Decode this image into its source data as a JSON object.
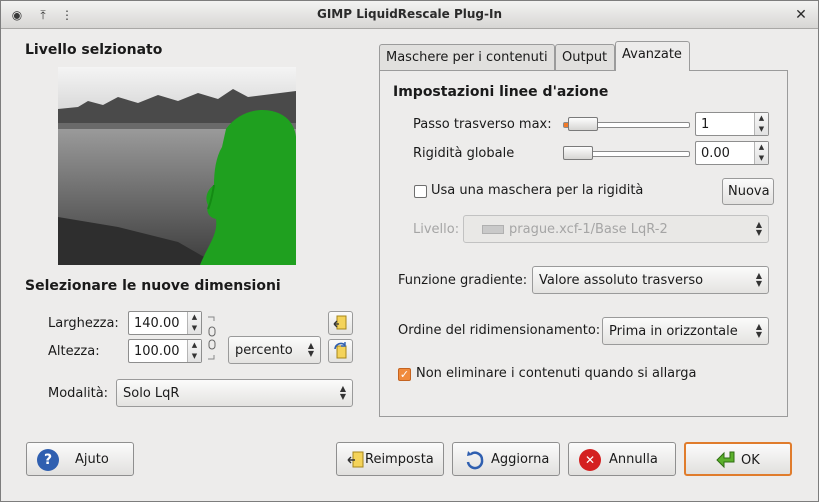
{
  "window": {
    "title": "GIMP LiquidRescale Plug-In"
  },
  "left": {
    "selected_layer_heading": "Livello selzionato",
    "new_size_heading": "Selezionare le nuove dimensioni",
    "width_label": "Larghezza:",
    "width_value": "140.00",
    "height_label": "Altezza:",
    "height_value": "100.00",
    "unit_value": "percento",
    "mode_label": "Modalità:",
    "mode_value": "Solo LqR"
  },
  "tabs": [
    {
      "label": "Maschere per i contenuti"
    },
    {
      "label": "Output"
    },
    {
      "label": "Avanzate"
    }
  ],
  "advanced": {
    "section_heading": "Impostazioni linee d'azione",
    "max_step_label": "Passo trasverso max:",
    "max_step_value": "1",
    "max_step_level": 0.05,
    "rigidity_label": "Rigidità globale",
    "rigidity_value": "0.00",
    "rigidity_level": 0.0,
    "rigidity_mask_label": "Usa una maschera per la rigidità",
    "rigidity_mask_checked": false,
    "new_button_label": "Nuova",
    "layer_label": "Livello:",
    "layer_value": "prague.xcf-1/Base LqR-2",
    "gradient_label": "Funzione gradiente:",
    "gradient_value": "Valore assoluto trasverso",
    "order_label": "Ordine del ridimensionamento:",
    "order_value": "Prima in orizzontale",
    "no_delete_label": "Non eliminare i contenuti quando si allarga",
    "no_delete_checked": true
  },
  "buttons": {
    "help": "Ajuto",
    "reset": "Reimposta",
    "refresh": "Aggiorna",
    "cancel": "Annulla",
    "ok": "OK"
  },
  "colors": {
    "accent_orange": "#f07a2a",
    "mask_green": "#1fa01f",
    "help_blue": "#2f5fb0",
    "cancel_red": "#d42020",
    "ok_green": "#3a8f1e"
  }
}
